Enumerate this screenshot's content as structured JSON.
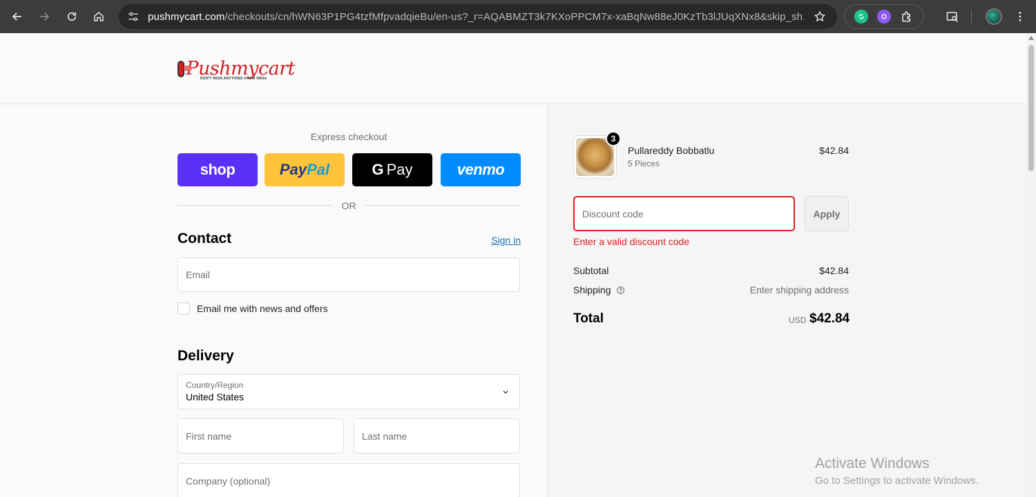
{
  "browser": {
    "url_host": "pushmycart.com",
    "url_rest": "/checkouts/cn/hWN63P1PG4tzfMfpvadqieBu/en-us?_r=AQABMZT3k7KXoPPCM7x-xaBqNw88eJ0KzTb3lJUqXNx8&skip_sh..."
  },
  "logo": {
    "text": "Pushmycart",
    "tagline": "DON'T MISS ANYTHING FROM INDIA"
  },
  "express": {
    "label": "Express checkout",
    "shop": "shop",
    "paypal_a": "Pay",
    "paypal_b": "Pal",
    "gpay_g": "G",
    "gpay_text": "Pay",
    "venmo": "venmo",
    "or": "OR"
  },
  "contact": {
    "title": "Contact",
    "signin": "Sign in",
    "email_placeholder": "Email",
    "newsletter_label": "Email me with news and offers"
  },
  "delivery": {
    "title": "Delivery",
    "country_label": "Country/Region",
    "country_value": "United States",
    "first_name_placeholder": "First name",
    "last_name_placeholder": "Last name",
    "company_placeholder": "Company (optional)"
  },
  "order": {
    "quantity": "3",
    "product_name": "Pullareddy Bobbatlu",
    "product_variant": "5 Pieces",
    "product_price": "$42.84",
    "discount_placeholder": "Discount code",
    "apply_label": "Apply",
    "discount_error": "Enter a valid discount code",
    "subtotal_label": "Subtotal",
    "subtotal_value": "$42.84",
    "shipping_label": "Shipping",
    "shipping_value": "Enter shipping address",
    "total_label": "Total",
    "total_currency": "USD",
    "total_value": "$42.84"
  },
  "watermark": {
    "title": "Activate Windows",
    "subtitle": "Go to Settings to activate Windows."
  }
}
